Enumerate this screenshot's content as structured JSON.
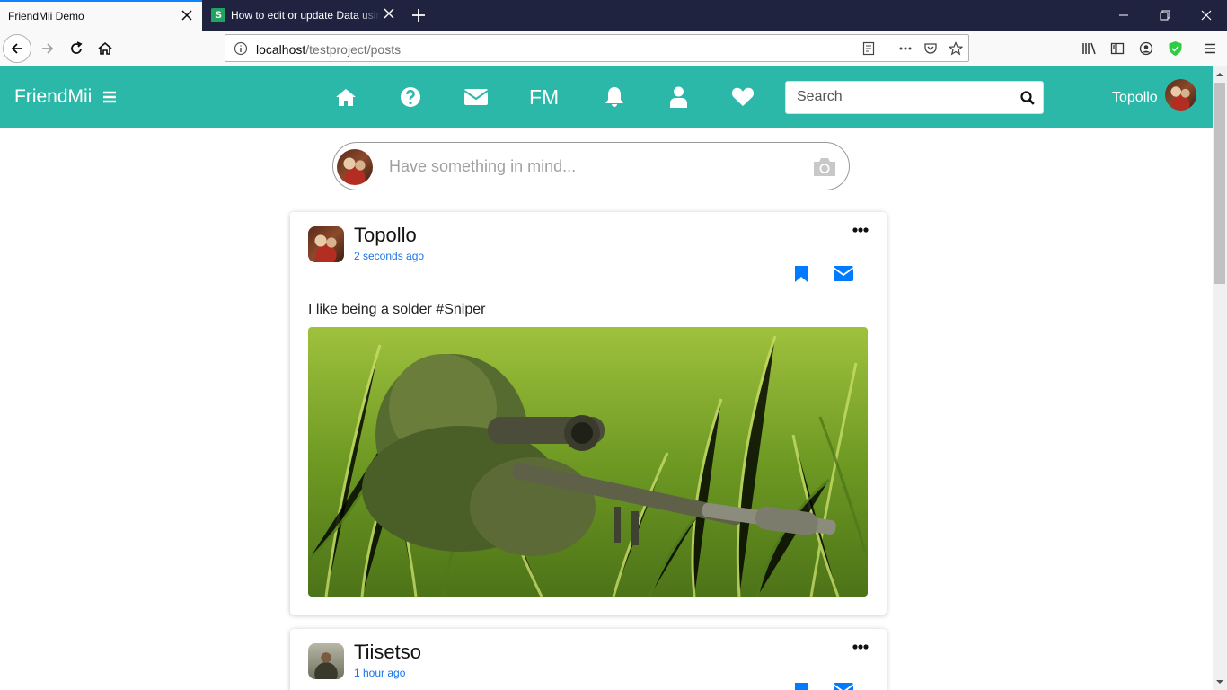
{
  "browser": {
    "tabs": [
      {
        "title": "FriendMii Demo",
        "active": true
      },
      {
        "title": "How to edit or update Data using",
        "active": false,
        "favicon": "S"
      }
    ],
    "url_host": "localhost",
    "url_path": "/testproject/posts"
  },
  "header": {
    "brand": "FriendMii",
    "fm_label": "FM",
    "search_placeholder": "Search",
    "user_name": "Topollo",
    "nav_icons": [
      "home-icon",
      "question-icon",
      "envelope-icon",
      "bell-icon",
      "user-icon",
      "heart-icon"
    ],
    "color": "#2cb8a8"
  },
  "compose": {
    "placeholder": "Have something in mind..."
  },
  "posts": [
    {
      "author": "Topollo",
      "time": "2 seconds ago",
      "text": "I like being a solder #Sniper"
    },
    {
      "author": "Tiisetso",
      "time": "1 hour ago"
    }
  ],
  "colors": {
    "accent": "#007bff",
    "link": "#1a73e8"
  }
}
